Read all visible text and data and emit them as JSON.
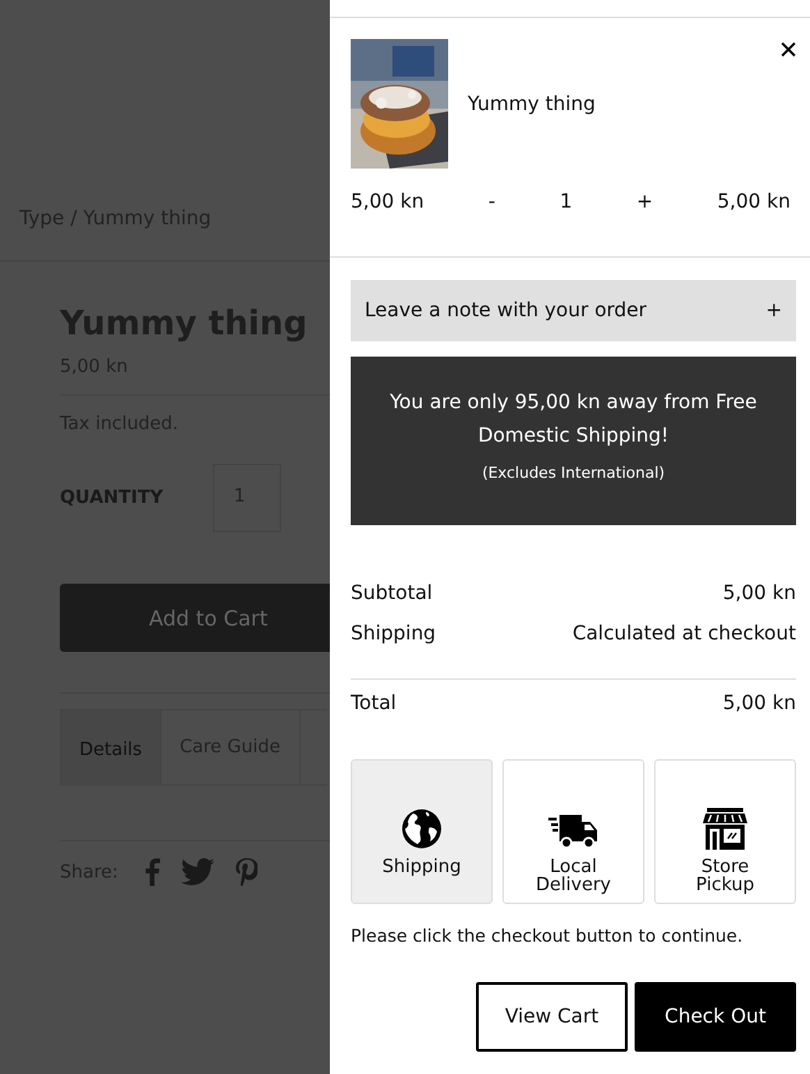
{
  "page": {
    "breadcrumb": "Type / Yummy thing",
    "title": "Yummy thing",
    "price": "5,00 kn",
    "tax_note": "Tax included.",
    "quantity_label": "QUANTITY",
    "quantity_value": "1",
    "add_to_cart": "Add to Cart",
    "tabs": [
      {
        "label": "Details",
        "selected": true
      },
      {
        "label": "Care Guide",
        "selected": false
      }
    ],
    "share_label": "Share:"
  },
  "cart": {
    "item": {
      "name": "Yummy thing",
      "unit_price": "5,00 kn",
      "decrement": "-",
      "quantity": "1",
      "increment": "+",
      "line_total": "5,00 kn"
    },
    "note_toggle": {
      "label": "Leave a note with your order",
      "icon": "+"
    },
    "shipping_notice": {
      "message": "You are only 95,00 kn away from Free Domestic Shipping!",
      "note": "(Excludes International)"
    },
    "summary": [
      {
        "label": "Subtotal",
        "value": "5,00 kn"
      },
      {
        "label": "Shipping",
        "value": "Calculated at checkout"
      }
    ],
    "total": {
      "label": "Total",
      "value": "5,00 kn"
    },
    "delivery_methods": [
      {
        "kind": "globe",
        "label": "Shipping",
        "selected": true
      },
      {
        "kind": "truck",
        "label": "Local Delivery",
        "selected": false
      },
      {
        "kind": "store",
        "label": "Store Pickup",
        "selected": false
      }
    ],
    "checkout_hint": "Please click the checkout button to continue.",
    "buttons": {
      "view_cart": "View Cart",
      "check_out": "Check Out"
    }
  }
}
